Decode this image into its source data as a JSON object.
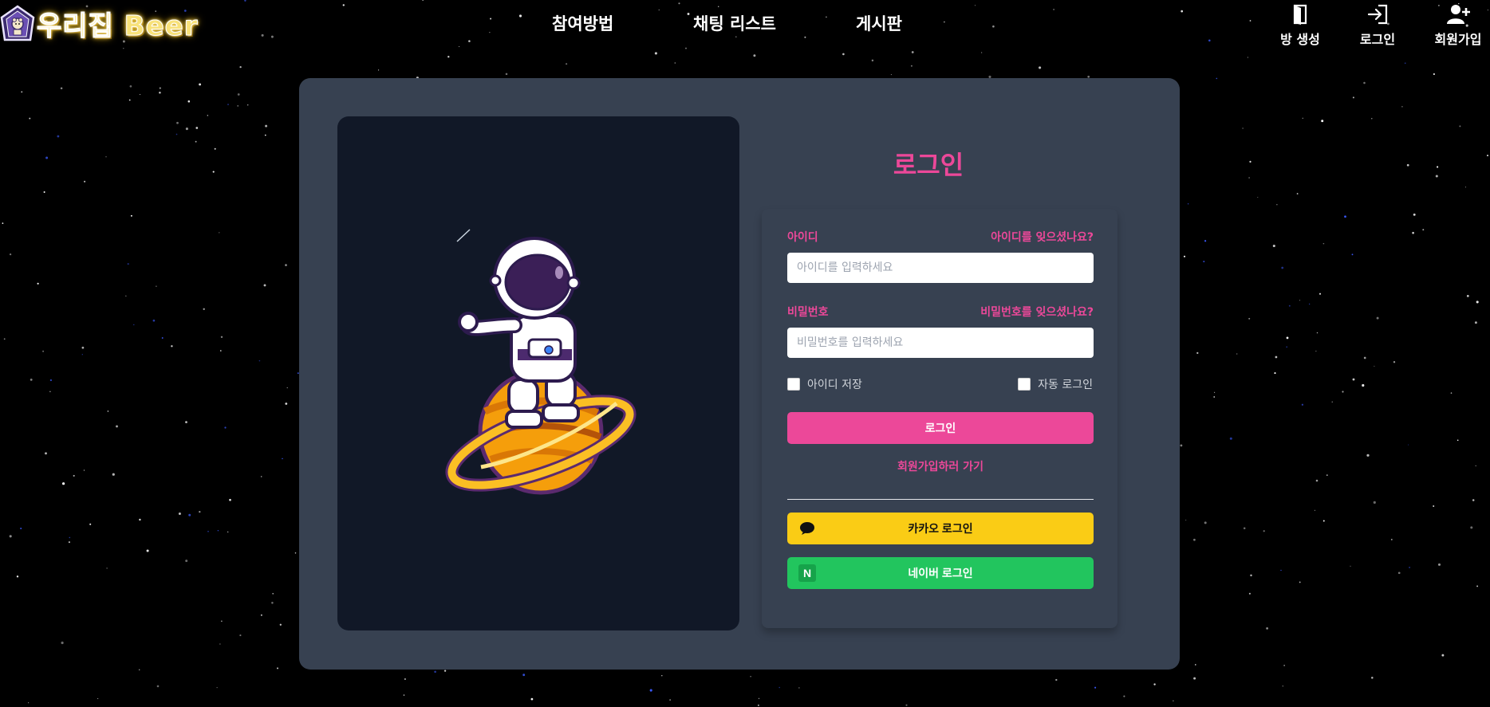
{
  "header": {
    "logo_text": "우리집 Beer",
    "nav": [
      "참여방법",
      "채팅 리스트",
      "게시판"
    ],
    "actions": [
      {
        "label": "방 생성",
        "icon": "door-icon"
      },
      {
        "label": "로그인",
        "icon": "login-arrow-icon"
      },
      {
        "label": "회원가입",
        "icon": "user-plus-icon"
      }
    ]
  },
  "login": {
    "title": "로그인",
    "id_label": "아이디",
    "forgot_id": "아이디를 잊으셨나요?",
    "id_placeholder": "아이디를 입력하세요",
    "pw_label": "비밀번호",
    "forgot_pw": "비밀번호를 잊으셨나요?",
    "pw_placeholder": "비밀번호를 입력하세요",
    "save_id": "아이디 저장",
    "auto_login": "자동 로그인",
    "login_button": "로그인",
    "signup_link": "회원가입하러 가기",
    "kakao_button": "카카오 로그인",
    "naver_button": "네이버 로그인",
    "naver_logo_letter": "N"
  },
  "colors": {
    "accent": "#ec4899",
    "card": "#374151",
    "panel": "#111827",
    "kakao": "#facc15",
    "naver": "#22c55e"
  }
}
